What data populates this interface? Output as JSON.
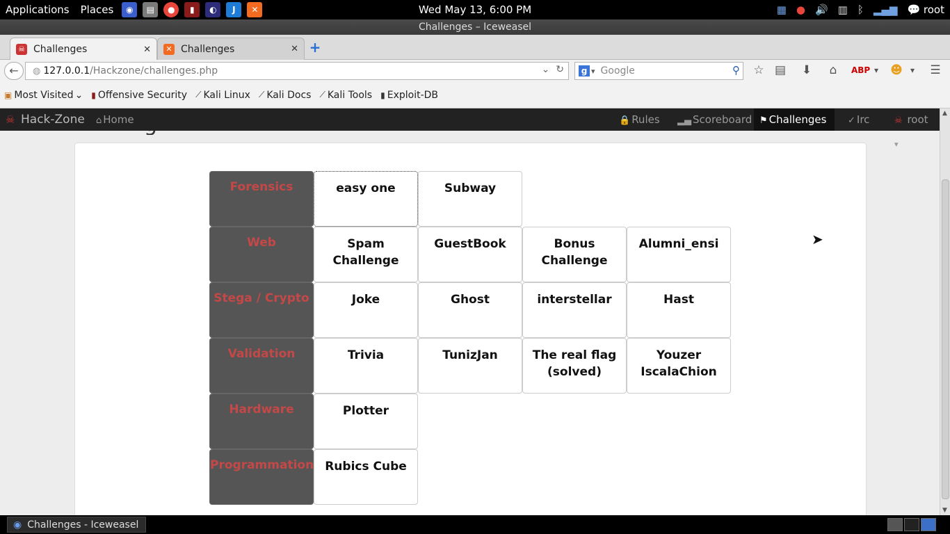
{
  "system_panel": {
    "applications": "Applications",
    "places": "Places",
    "clock": "Wed May 13,  6:00 PM",
    "user": "root",
    "launchers": [
      "network-icon",
      "files-icon",
      "chrome-icon",
      "terminal-icon",
      "eclipse-icon",
      "ide-icon",
      "xampp-icon"
    ]
  },
  "window": {
    "title": "Challenges – Iceweasel"
  },
  "tabs": [
    {
      "label": "Challenges",
      "close": "✕"
    },
    {
      "label": "Challenges",
      "close": "✕"
    }
  ],
  "new_tab": "+",
  "url": {
    "host": "127.0.0.1",
    "path": "/Hackzone/challenges.php"
  },
  "search": {
    "engine": "g",
    "placeholder": "Google"
  },
  "bookmarks": [
    {
      "label": "Most Visited",
      "chevron": "⌄"
    },
    {
      "label": "Offensive Security"
    },
    {
      "label": "Kali Linux"
    },
    {
      "label": "Kali Docs"
    },
    {
      "label": "Kali Tools"
    },
    {
      "label": "Exploit-DB"
    }
  ],
  "site": {
    "brand": "Hack-Zone",
    "nav": {
      "home": "Home",
      "rules": "Rules",
      "scoreboard": "Scoreboard",
      "challenges": "Challenges",
      "irc": "Irc",
      "user": "root"
    },
    "heading_fragment": "g"
  },
  "categories": [
    {
      "name": "Forensics",
      "challenges": [
        "easy one",
        "Subway"
      ]
    },
    {
      "name": "Web",
      "challenges": [
        "Spam Challenge",
        "GuestBook",
        "Bonus Challenge",
        "Alumni_ensi"
      ]
    },
    {
      "name": "Stega / Crypto",
      "challenges": [
        "Joke",
        "Ghost",
        "interstellar",
        "Hast"
      ]
    },
    {
      "name": "Validation",
      "challenges": [
        "Trivia",
        "TunizJan",
        "The real flag (solved)",
        "Youzer IscalaChion"
      ]
    },
    {
      "name": "Hardware",
      "challenges": [
        "Plotter"
      ]
    },
    {
      "name": "Programmation",
      "challenges": [
        "Rubics Cube"
      ]
    }
  ],
  "taskbar": {
    "task": "Challenges - Iceweasel"
  },
  "colors": {
    "category_text": "#c44848",
    "category_bg": "#555555",
    "site_nav_bg": "#222222"
  }
}
